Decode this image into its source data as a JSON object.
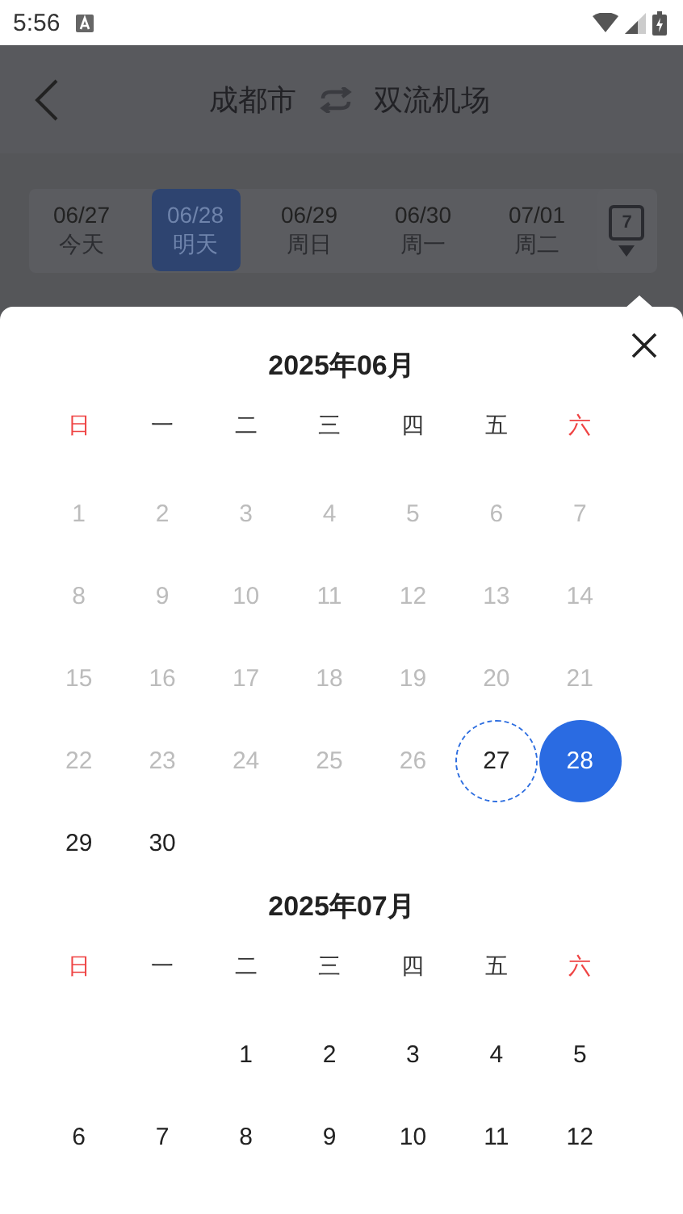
{
  "status_bar": {
    "time": "5:56"
  },
  "header": {
    "origin": "成都市",
    "destination": "双流机场"
  },
  "date_strip": [
    {
      "date": "06/27",
      "weekday": "今天",
      "selected": false
    },
    {
      "date": "06/28",
      "weekday": "明天",
      "selected": true
    },
    {
      "date": "06/29",
      "weekday": "周日",
      "selected": false
    },
    {
      "date": "06/30",
      "weekday": "周一",
      "selected": false
    },
    {
      "date": "07/01",
      "weekday": "周二",
      "selected": false
    }
  ],
  "calendar_button": {
    "label": "7"
  },
  "months": [
    {
      "title": "2025年06月",
      "weekdays": [
        {
          "label": "日",
          "weekend": true
        },
        {
          "label": "一",
          "weekend": false
        },
        {
          "label": "二",
          "weekend": false
        },
        {
          "label": "三",
          "weekend": false
        },
        {
          "label": "四",
          "weekend": false
        },
        {
          "label": "五",
          "weekend": false
        },
        {
          "label": "六",
          "weekend": true
        }
      ],
      "days": [
        {
          "day": "1",
          "kind": "past"
        },
        {
          "day": "2",
          "kind": "past"
        },
        {
          "day": "3",
          "kind": "past"
        },
        {
          "day": "4",
          "kind": "past"
        },
        {
          "day": "5",
          "kind": "past"
        },
        {
          "day": "6",
          "kind": "past"
        },
        {
          "day": "7",
          "kind": "past"
        },
        {
          "day": "8",
          "kind": "past"
        },
        {
          "day": "9",
          "kind": "past"
        },
        {
          "day": "10",
          "kind": "past"
        },
        {
          "day": "11",
          "kind": "past"
        },
        {
          "day": "12",
          "kind": "past"
        },
        {
          "day": "13",
          "kind": "past"
        },
        {
          "day": "14",
          "kind": "past"
        },
        {
          "day": "15",
          "kind": "past"
        },
        {
          "day": "16",
          "kind": "past"
        },
        {
          "day": "17",
          "kind": "past"
        },
        {
          "day": "18",
          "kind": "past"
        },
        {
          "day": "19",
          "kind": "past"
        },
        {
          "day": "20",
          "kind": "past"
        },
        {
          "day": "21",
          "kind": "past"
        },
        {
          "day": "22",
          "kind": "past"
        },
        {
          "day": "23",
          "kind": "past"
        },
        {
          "day": "24",
          "kind": "past"
        },
        {
          "day": "25",
          "kind": "past"
        },
        {
          "day": "26",
          "kind": "past"
        },
        {
          "day": "27",
          "kind": "today"
        },
        {
          "day": "28",
          "kind": "selected"
        },
        {
          "day": "29",
          "kind": "normal"
        },
        {
          "day": "30",
          "kind": "normal"
        }
      ]
    },
    {
      "title": "2025年07月",
      "weekdays": [
        {
          "label": "日",
          "weekend": true
        },
        {
          "label": "一",
          "weekend": false
        },
        {
          "label": "二",
          "weekend": false
        },
        {
          "label": "三",
          "weekend": false
        },
        {
          "label": "四",
          "weekend": false
        },
        {
          "label": "五",
          "weekend": false
        },
        {
          "label": "六",
          "weekend": true
        }
      ],
      "days": [
        {
          "kind": "blank"
        },
        {
          "kind": "blank"
        },
        {
          "day": "1",
          "kind": "normal"
        },
        {
          "day": "2",
          "kind": "normal"
        },
        {
          "day": "3",
          "kind": "normal"
        },
        {
          "day": "4",
          "kind": "normal"
        },
        {
          "day": "5",
          "kind": "normal"
        },
        {
          "day": "6",
          "kind": "normal"
        },
        {
          "day": "7",
          "kind": "normal"
        },
        {
          "day": "8",
          "kind": "normal"
        },
        {
          "day": "9",
          "kind": "normal"
        },
        {
          "day": "10",
          "kind": "normal"
        },
        {
          "day": "11",
          "kind": "normal"
        },
        {
          "day": "12",
          "kind": "normal"
        }
      ]
    }
  ]
}
